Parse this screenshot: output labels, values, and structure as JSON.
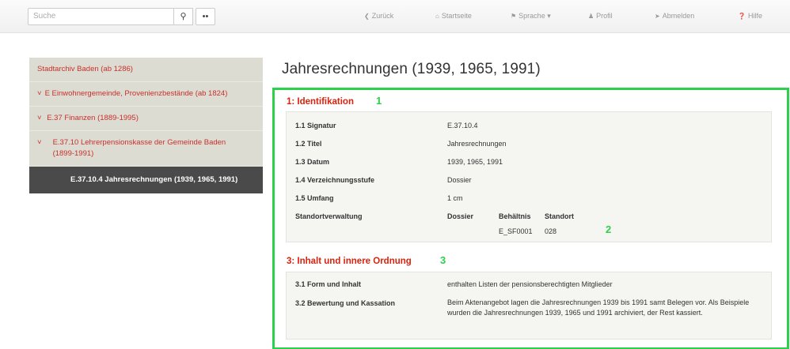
{
  "search": {
    "placeholder": "Suche"
  },
  "navbar": {
    "back": "Zurück",
    "home": "Startseite",
    "language": "Sprache ▾",
    "profile": "Profil",
    "logout": "Abmelden",
    "help": "Hilfe"
  },
  "sidebar": {
    "items": [
      {
        "label": "Stadtarchiv Baden (ab 1286)"
      },
      {
        "label": "E Einwohnergemeinde, Provenienzbestände (ab 1824)"
      },
      {
        "label": "E.37 Finanzen (1889-1995)"
      },
      {
        "label": "E.37.10 Lehrerpensionskasse der Gemeinde Baden (1899-1991)"
      },
      {
        "label": "E.37.10.4 Jahresrechnungen (1939, 1965, 1991)"
      }
    ]
  },
  "main": {
    "title": "Jahresrechnungen (1939, 1965, 1991)",
    "section1": {
      "title": "1: Identifikation",
      "annotation": "1",
      "rows": [
        {
          "label": "1.1 Signatur",
          "value": "E.37.10.4"
        },
        {
          "label": "1.2 Titel",
          "value": "Jahresrechnungen"
        },
        {
          "label": "1.3 Datum",
          "value": "1939, 1965, 1991"
        },
        {
          "label": "1.4 Verzeichnungsstufe",
          "value": "Dossier"
        },
        {
          "label": "1.5 Umfang",
          "value": "1 cm"
        }
      ],
      "standort": {
        "label": "Standortverwaltung",
        "headers": [
          "Dossier",
          "Behältnis",
          "Standort"
        ],
        "cells": [
          "E_SF0001",
          "028"
        ],
        "annotation": "2"
      }
    },
    "section3": {
      "title": "3: Inhalt und innere Ordnung",
      "annotation": "3",
      "rows": [
        {
          "label": "3.1 Form und Inhalt",
          "value": "enthalten Listen der pensionsberechtigten Mitglieder"
        },
        {
          "label": "3.2 Bewertung und Kassation",
          "value": "Beim Aktenangebot lagen die Jahresrechnungen 1939 bis 1991 samt Belegen vor. Als Beispiele wurden die Jahresrechnungen 1939, 1965 und 1991 archiviert, der Rest kassiert."
        }
      ]
    }
  }
}
